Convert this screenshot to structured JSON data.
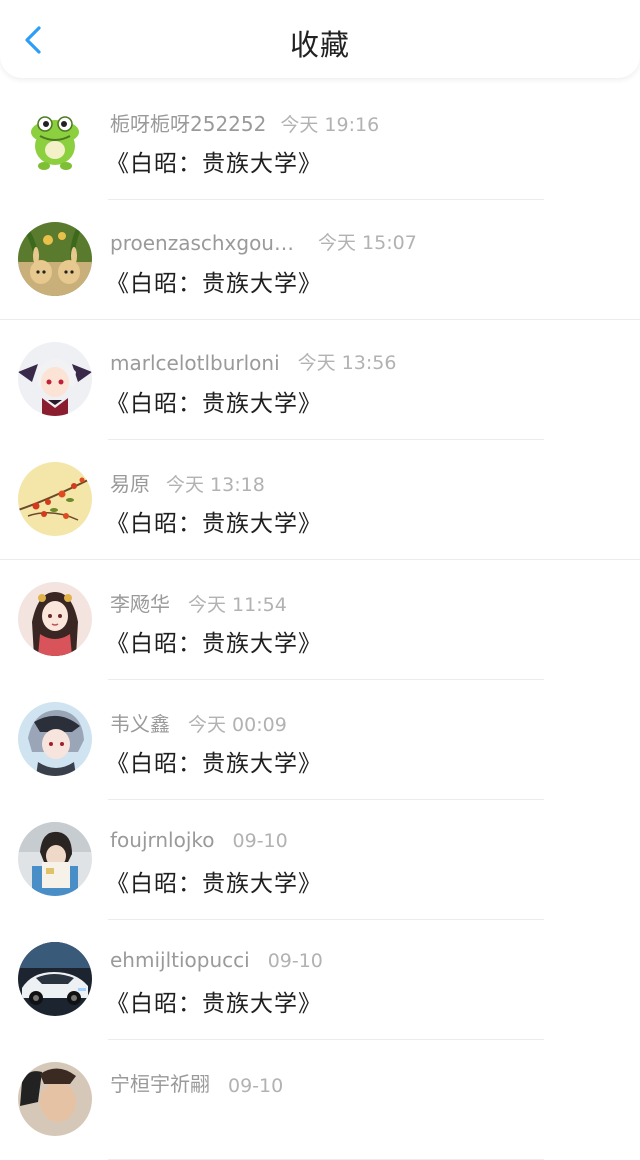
{
  "header": {
    "title": "收藏"
  },
  "colors": {
    "accent": "#2d9df5",
    "title_text": "#222222",
    "meta_text": "#9a9a9a"
  },
  "favorites": [
    {
      "user": "栀呀栀呀252252",
      "time": "今天 19:16",
      "title": "《白昭：贵族大学》",
      "avatar": "green-dinosaur"
    },
    {
      "user": "proenzaschxgou…",
      "time": "今天 15:07",
      "title": "《白昭：贵族大学》",
      "avatar": "rabbits-plants"
    },
    {
      "user": "marlcelotlburloni",
      "time": "今天 13:56",
      "title": "《白昭：贵族大学》",
      "avatar": "anime-vampire"
    },
    {
      "user": "易原",
      "time": "今天 13:18",
      "title": "《白昭：贵族大学》",
      "avatar": "red-flowers"
    },
    {
      "user": "李飏华",
      "time": "今天 11:54",
      "title": "《白昭：贵族大学》",
      "avatar": "anime-girl-red"
    },
    {
      "user": "韦义鑫",
      "time": "今天 00:09",
      "title": "《白昭：贵族大学》",
      "avatar": "anime-boy-silver"
    },
    {
      "user": "foujrnlojko",
      "time": "09-10",
      "title": "《白昭：贵族大学》",
      "avatar": "person-reading"
    },
    {
      "user": "ehmijltiopucci",
      "time": "09-10",
      "title": "《白昭：贵族大学》",
      "avatar": "white-car"
    },
    {
      "user": "宁桓宇祈翤",
      "time": "09-10",
      "title": "",
      "avatar": "person-photo"
    }
  ]
}
